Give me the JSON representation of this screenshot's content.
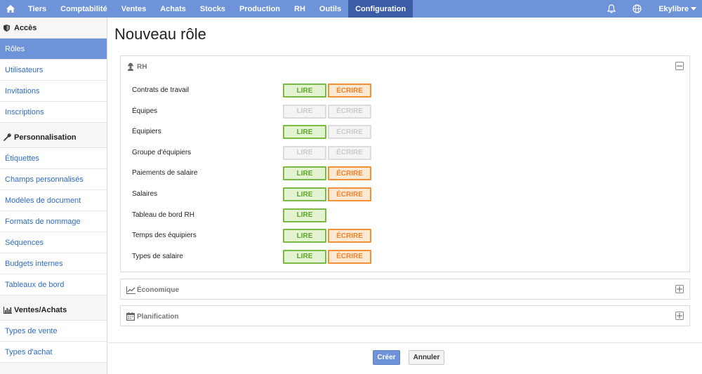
{
  "topnav": {
    "home_icon": "home-icon",
    "items": [
      "Tiers",
      "Comptabilité",
      "Ventes",
      "Achats",
      "Stocks",
      "Production",
      "RH",
      "Outils",
      "Configuration"
    ],
    "active": "Configuration",
    "user": "Ekylibre",
    "bell_icon": "bell-icon",
    "globe_icon": "globe-icon",
    "caret_icon": "caret-down-icon"
  },
  "sidebar": {
    "acces": {
      "title": "Accès",
      "icon": "shield-icon",
      "items": [
        "Rôles",
        "Utilisateurs",
        "Invitations",
        "Inscriptions"
      ]
    },
    "perso": {
      "title": "Personnalisation",
      "icon": "wrench-icon",
      "items": [
        "Étiquettes",
        "Champs personnalisés",
        "Modèles de document",
        "Formats de nommage",
        "Séquences",
        "Budgets internes",
        "Tableaux de bord"
      ]
    },
    "ventes": {
      "title": "Ventes/Achats",
      "icon": "bar-chart-icon",
      "items": [
        "Types de vente",
        "Types d'achat"
      ]
    }
  },
  "page": {
    "title": "Nouveau rôle"
  },
  "panels": {
    "rh": {
      "title": "RH",
      "icon": "worker-icon",
      "rows": [
        {
          "label": "Contrats de travail",
          "lire": "LIRE",
          "ecrire": "ÉCRIRE",
          "lire_on": true,
          "ecrire_on": true,
          "has_ecrire": true
        },
        {
          "label": "Équipes",
          "lire": "LIRE",
          "ecrire": "ÉCRIRE",
          "lire_on": false,
          "ecrire_on": false,
          "has_ecrire": true
        },
        {
          "label": "Équipiers",
          "lire": "LIRE",
          "ecrire": "ÉCRIRE",
          "lire_on": true,
          "ecrire_on": false,
          "has_ecrire": true
        },
        {
          "label": "Groupe d'équipiers",
          "lire": "LIRE",
          "ecrire": "ÉCRIRE",
          "lire_on": false,
          "ecrire_on": false,
          "has_ecrire": true
        },
        {
          "label": "Paiements de salaire",
          "lire": "LIRE",
          "ecrire": "ÉCRIRE",
          "lire_on": true,
          "ecrire_on": true,
          "has_ecrire": true
        },
        {
          "label": "Salaires",
          "lire": "LIRE",
          "ecrire": "ÉCRIRE",
          "lire_on": true,
          "ecrire_on": true,
          "has_ecrire": true
        },
        {
          "label": "Tableau de bord RH",
          "lire": "LIRE",
          "ecrire": "",
          "lire_on": true,
          "ecrire_on": false,
          "has_ecrire": false
        },
        {
          "label": "Temps des équipiers",
          "lire": "LIRE",
          "ecrire": "ÉCRIRE",
          "lire_on": true,
          "ecrire_on": true,
          "has_ecrire": true
        },
        {
          "label": "Types de salaire",
          "lire": "LIRE",
          "ecrire": "ÉCRIRE",
          "lire_on": true,
          "ecrire_on": true,
          "has_ecrire": true
        }
      ]
    },
    "economique": {
      "title": "Économique",
      "icon": "line-chart-icon"
    },
    "planification": {
      "title": "Planification",
      "icon": "calendar-icon"
    }
  },
  "footer": {
    "create_label": "Créer",
    "cancel_label": "Annuler"
  },
  "colors": {
    "nav": "#6e93d8",
    "nav_active": "#3a5da6",
    "lire": "#7cba46",
    "ecrire": "#f29135",
    "link": "#2f6bc4"
  }
}
